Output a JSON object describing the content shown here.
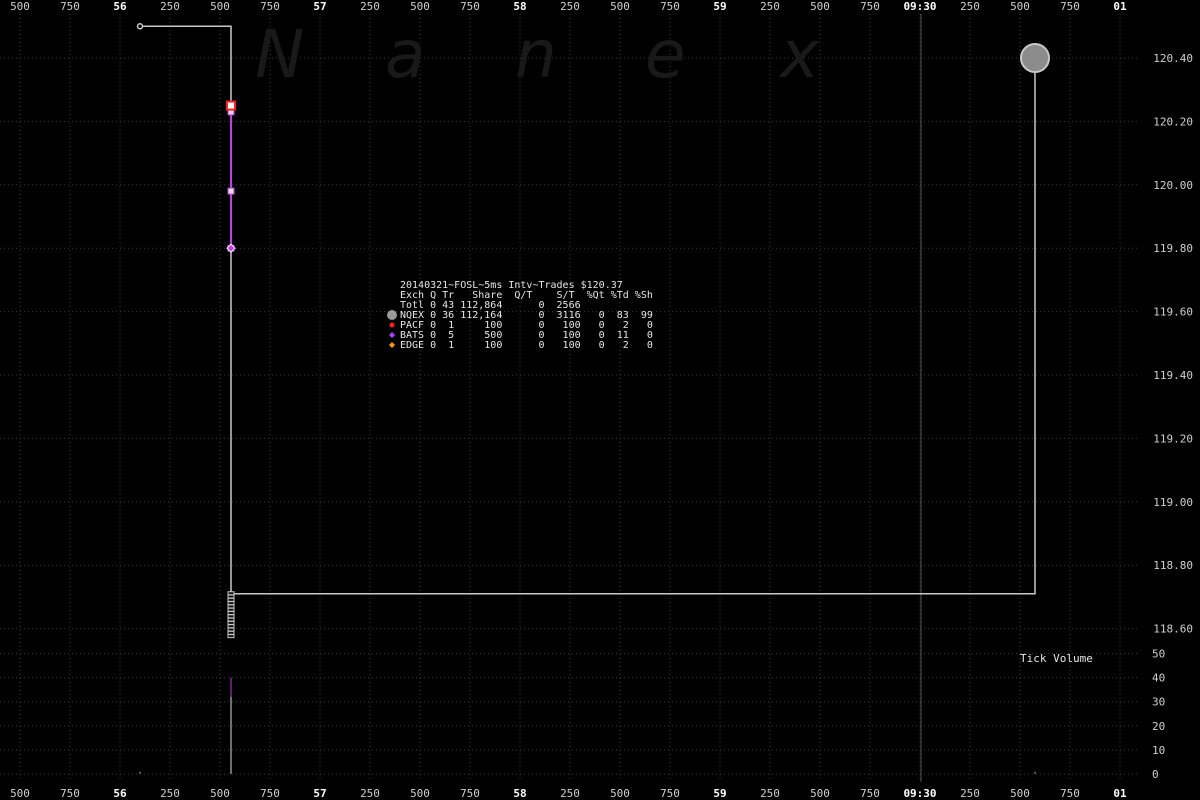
{
  "watermark": [
    "N",
    "a",
    "n",
    "e",
    "x"
  ],
  "time_axis": {
    "labels": [
      "500",
      "750",
      "56",
      "250",
      "500",
      "750",
      "57",
      "250",
      "500",
      "750",
      "58",
      "250",
      "500",
      "750",
      "59",
      "250",
      "500",
      "750",
      "09:30",
      "250",
      "500",
      "750",
      "01"
    ],
    "bold_labels": [
      "56",
      "57",
      "58",
      "59",
      "09:30",
      "01"
    ],
    "marker_label": "09:30"
  },
  "price_axis": {
    "labels": [
      "120.40",
      "120.20",
      "120.00",
      "119.80",
      "119.60",
      "119.40",
      "119.20",
      "119.00",
      "118.80",
      "118.60"
    ]
  },
  "volume_axis": {
    "title": "Tick Volume",
    "labels": [
      "50",
      "40",
      "30",
      "20",
      "10",
      "0"
    ]
  },
  "legend": {
    "title": "20140321~FOSL~5ms Intv~Trades $120.37",
    "header": "Exch Q Tr   Share  Q/T    S/T  %Qt %Td %Sh",
    "rows": [
      {
        "text": "Totl 0 43 112,864      0  2566",
        "marker": "none",
        "color": ""
      },
      {
        "text": "NQEX 0 36 112,164      0  3116   0  83  99",
        "marker": "circle",
        "color": "#9a9a9a"
      },
      {
        "text": "PACF 0  1     100      0   100   0   2   0",
        "marker": "dot",
        "color": "#ff2020"
      },
      {
        "text": "BATS 0  5     500      0   100   0  11   0",
        "marker": "diamond",
        "color": "#b040ff"
      },
      {
        "text": "EDGE 0  1     100      0   100   0   2   0",
        "marker": "diamond",
        "color": "#ff9900"
      }
    ]
  },
  "colors": {
    "background": "#000000",
    "grid": "#3a3a3a",
    "nqex": "#c8c8c8",
    "bats": "#c040e0",
    "pacf": "#ff2020",
    "edge": "#ff9900",
    "marker_line": "#555555"
  },
  "chart_data": {
    "type": "line",
    "title": "20140321~FOSL~5ms Intv~Trades $120.37",
    "ylim": [
      118.52,
      120.5
    ],
    "y_ticks": [
      120.4,
      120.2,
      120.0,
      119.8,
      119.6,
      119.4,
      119.2,
      119.0,
      118.8,
      118.6
    ],
    "grid": true,
    "series": [
      {
        "name": "NQEX",
        "points": [
          {
            "t": "56.100",
            "price": 120.5
          },
          {
            "t": "56.555",
            "price": 120.5
          },
          {
            "t": "56.555",
            "price": 118.71
          },
          {
            "t": "00.575",
            "price": 118.71
          },
          {
            "t": "00.575",
            "price": 120.4
          }
        ]
      },
      {
        "name": "BATS",
        "points": [
          {
            "t": "56.555",
            "price": 120.23
          },
          {
            "t": "56.555",
            "price": 119.98
          },
          {
            "t": "56.555",
            "price": 119.8
          }
        ]
      },
      {
        "name": "PACF",
        "points": [
          {
            "t": "56.555",
            "price": 120.25
          }
        ]
      },
      {
        "name": "EDGE",
        "points": [
          {
            "t": "56.555",
            "price": 119.8
          }
        ]
      }
    ],
    "volume": {
      "title": "Tick Volume",
      "ylim": [
        0,
        50
      ],
      "bars": [
        {
          "t": "56.555",
          "value": 40
        },
        {
          "t": "56.100",
          "value": 1
        },
        {
          "t": "00.575",
          "value": 1
        }
      ]
    }
  }
}
